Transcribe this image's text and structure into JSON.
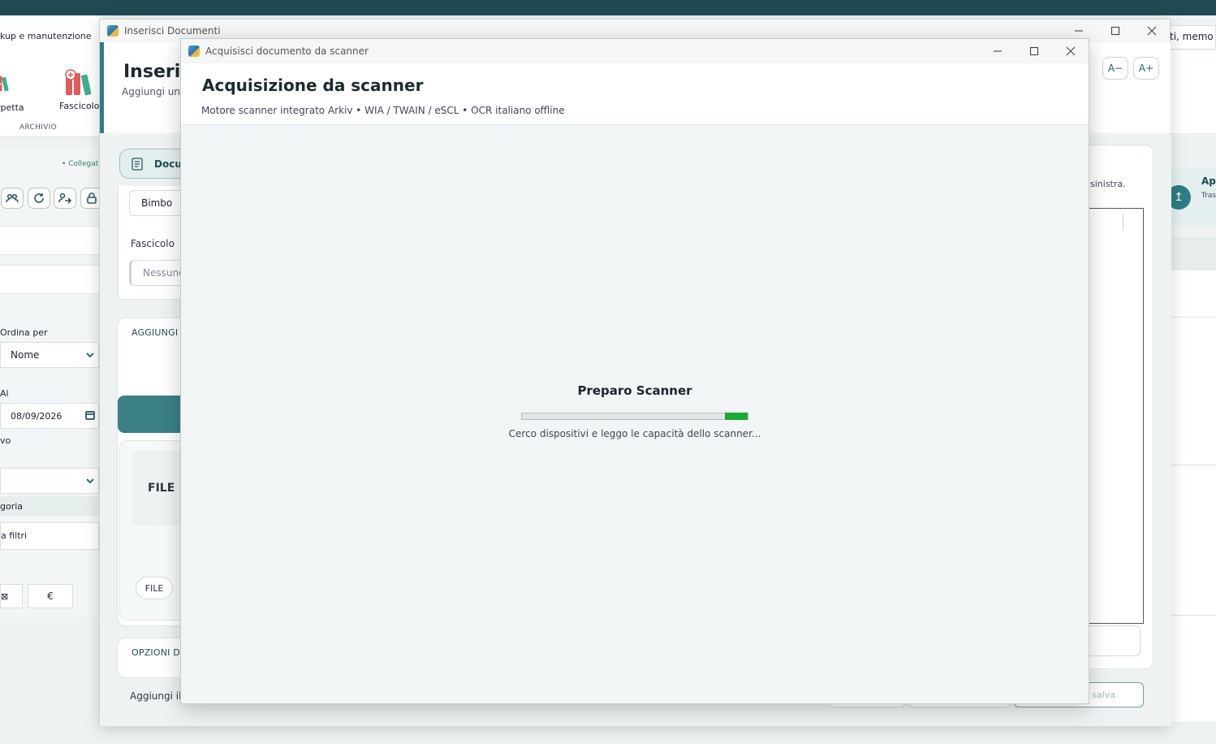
{
  "background_app": {
    "ribbon_title": "kup e manutenzione",
    "ribbon_items": [
      {
        "label": "rpetta",
        "icon": "folder-binders-icon"
      },
      {
        "label": "Fascicolo",
        "icon": "folder-binders-add-icon"
      }
    ],
    "archivio_label": "ARCHIVIO",
    "collegato": "• Collegat",
    "toolbar_icons": [
      "users-link-icon",
      "refresh-icon",
      "user-arrow-icon",
      "lock-icon"
    ],
    "ordina_per_label": "Ordina per",
    "ordina_per_value": "Nome",
    "al_label": "Al",
    "date_value": "08/09/2026",
    "vo_label": "vo",
    "categoria_label": "goria",
    "filtri_label": "a filtri",
    "euro_button": "€",
    "search_partial": "ti, memo",
    "apr_title": "Apr",
    "apr_sub": "Tras"
  },
  "insert_window": {
    "title": "Inserisci Documenti",
    "heading": "Inseris",
    "subheading": "Aggiungi un d",
    "font_minus": "A−",
    "font_plus": "A+",
    "doc_tab": "Docu",
    "bimbo_value": "Bimbo",
    "fascicolo_label": "Fascicolo",
    "fascicolo_placeholder": "Nessuno",
    "aggiungi_section": "AGGIUNGI /",
    "file_label": "FILE",
    "file_pill": "FILE",
    "opzioni_section": "OPZIONI DO",
    "footer_text": "Aggiungi il",
    "right_hint": "sinistra.",
    "salva_label": "salva"
  },
  "scanner_dialog": {
    "title": "Acquisisci documento da scanner",
    "heading": "Acquisizione da scanner",
    "subheading": "Motore scanner integrato Arkiv • WIA / TWAIN / eSCL • OCR italiano offline",
    "status_title": "Preparo Scanner",
    "status_detail": "Cerco dispositivi e leggo le capacità dello scanner...",
    "progress": {
      "indeterminate_segment_start": 0.9,
      "indeterminate_segment_end": 1.0,
      "color": "#1aa836"
    }
  }
}
